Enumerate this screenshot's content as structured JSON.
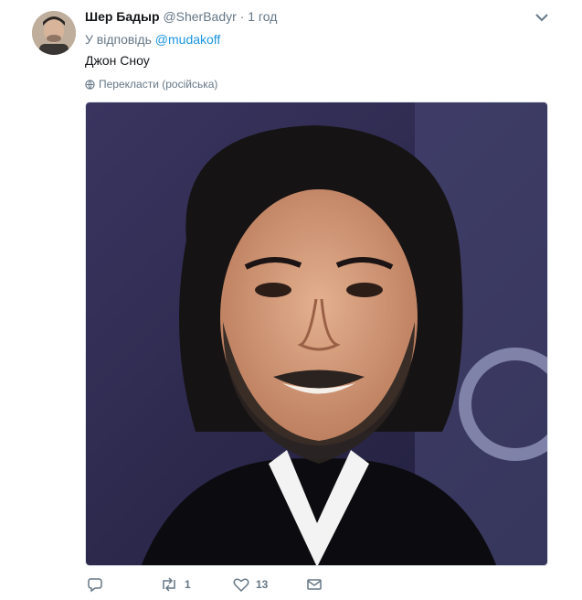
{
  "tweet": {
    "display_name": "Шер Бадыр",
    "handle": "@SherBadyr",
    "separator": "·",
    "time": "1 год",
    "reply_prefix": "У відповідь",
    "reply_to": "@mudakoff",
    "text": "Джон Сноу",
    "translate_label": "Перекласти (російська)"
  },
  "actions": {
    "replies": "",
    "retweets": "1",
    "likes": "13"
  },
  "colors": {
    "link": "#1b95e0",
    "muted": "#657786",
    "text": "#14171a"
  },
  "icons": [
    "avatar",
    "chevron-down-icon",
    "globe-icon",
    "reply-icon",
    "retweet-icon",
    "like-icon",
    "message-icon"
  ]
}
